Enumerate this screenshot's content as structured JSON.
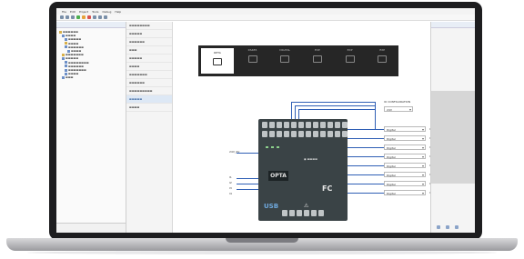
{
  "menubar": {
    "items": [
      "File",
      "Edit",
      "Project",
      "Tools",
      "Debug",
      "Help"
    ]
  },
  "models": [
    {
      "label": "OPTA"
    },
    {
      "label": "RS485"
    },
    {
      "label": "DIGITAL"
    },
    {
      "label": "EXP"
    },
    {
      "label": "EXP"
    },
    {
      "label": "EXP"
    }
  ],
  "device": {
    "model": "OPTA",
    "port": "USB",
    "badge": "FC"
  },
  "config_title": "IO CONFIGURATION",
  "config_value": "24V",
  "io_channels": [
    "I1",
    "I2",
    "I3",
    "I4",
    "I5",
    "I6",
    "I7",
    "I8"
  ],
  "io_values": [
    "Digital",
    "Digital",
    "Digital",
    "Digital",
    "Digital",
    "Digital",
    "Digital",
    "Digital"
  ],
  "left_labels": [
    "24V_0V",
    "I1",
    "I2",
    "I3",
    "I4"
  ]
}
